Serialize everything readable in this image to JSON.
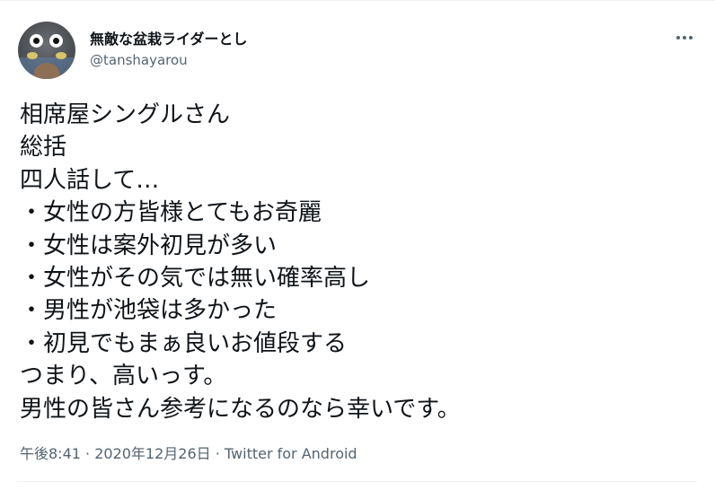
{
  "author": {
    "display_name": "無敵な盆栽ライダーとし",
    "handle": "@tanshayarou",
    "avatar_icon": "avatar-character-icon"
  },
  "more_icon": "more-horizontal-icon",
  "tweet": {
    "lines": [
      "相席屋シングルさん",
      "総括",
      "四人話して…",
      "・女性の方皆様とてもお奇麗",
      "・女性は案外初見が多い",
      "・女性がその気では無い確率高し",
      "・男性が池袋は多かった",
      "・初見でもまぁ良いお値段する",
      "つまり、高いっす。",
      "男性の皆さん参考になるのなら幸いです。"
    ]
  },
  "meta": {
    "time": "午後8:41",
    "separator1": " · ",
    "date": "2020年12月26日",
    "separator2": " · ",
    "source": "Twitter for Android"
  },
  "colors": {
    "text": "#0f1419",
    "secondary": "#536471",
    "divider": "#eff3f4"
  }
}
